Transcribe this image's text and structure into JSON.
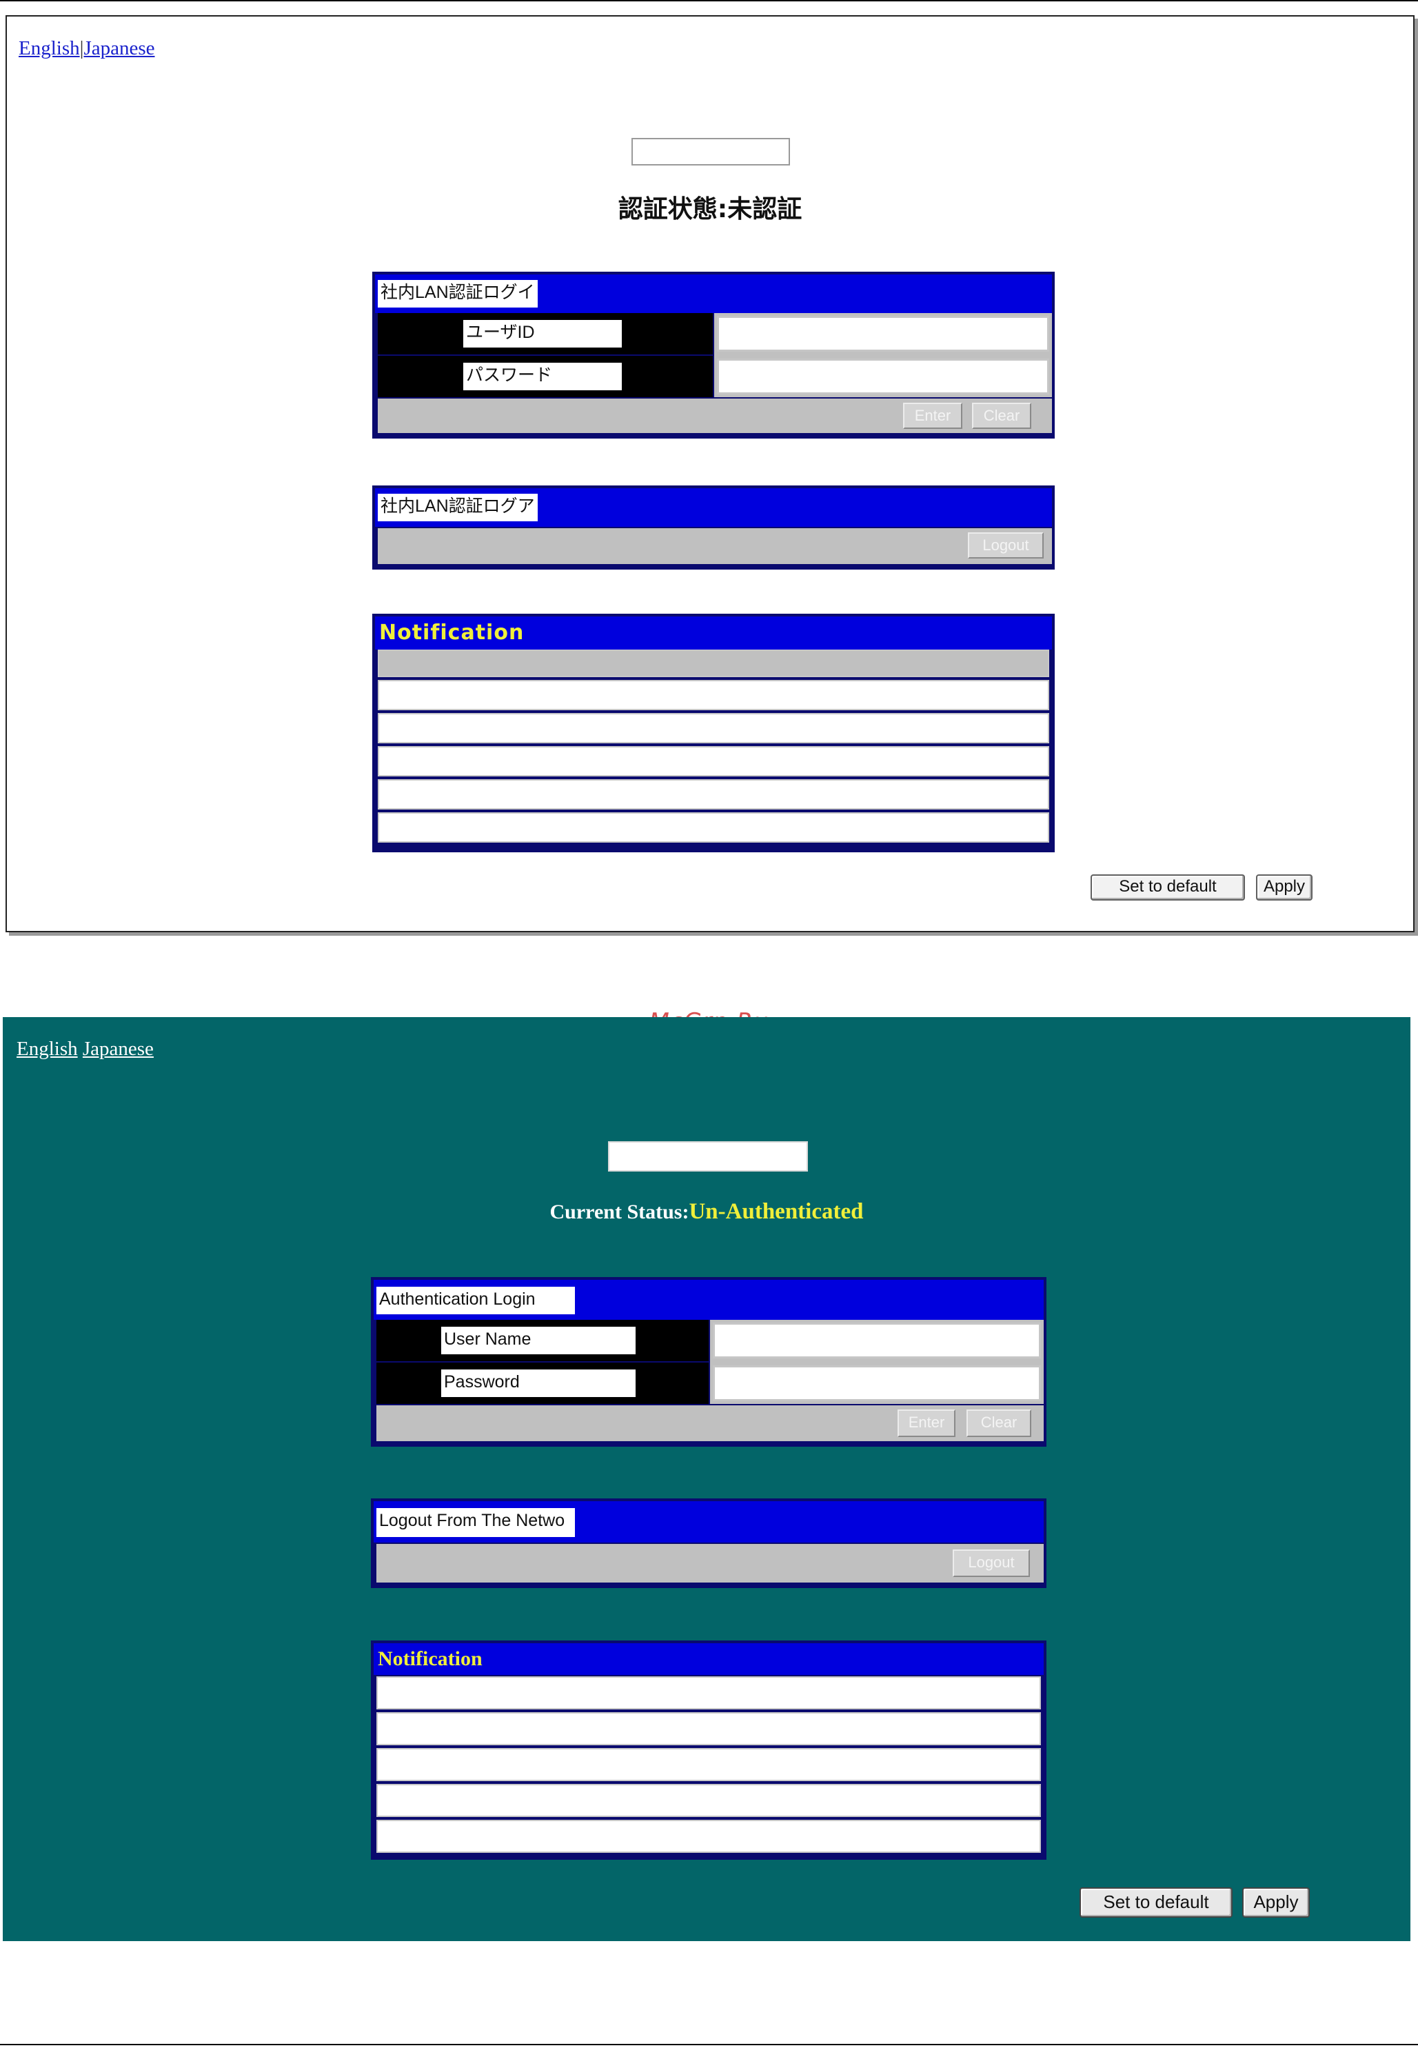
{
  "watermark": "McGrp.Ru",
  "japanese_screen": {
    "lang_english": "English",
    "lang_japanese": "Japanese",
    "status_text": "認証状態:未認証",
    "login_panel": {
      "caption": "社内LAN認証ログイ",
      "user_label": "ユーザID",
      "password_label": "パスワード",
      "user_value": "",
      "password_value": "",
      "enter_button": "Enter",
      "clear_button": "Clear"
    },
    "logout_panel": {
      "caption": "社内LAN認証ログア",
      "logout_button": "Logout"
    },
    "notification": {
      "title": "Notification",
      "rows": [
        "",
        "",
        "",
        "",
        "",
        ""
      ]
    },
    "set_default_button": "Set to default",
    "apply_button": "Apply"
  },
  "english_screen": {
    "lang_english": "English",
    "lang_japanese": "Japanese",
    "status_label": "Current Status:",
    "status_value": "Un-Authenticated",
    "login_panel": {
      "caption": "Authentication Login",
      "user_label": "User Name",
      "password_label": "Password",
      "user_value": "",
      "password_value": "",
      "enter_button": "Enter",
      "clear_button": "Clear"
    },
    "logout_panel": {
      "caption": "Logout From The Netwo",
      "logout_button": "Logout"
    },
    "notification": {
      "title": "Notification",
      "rows": [
        "",
        "",
        "",
        "",
        ""
      ]
    },
    "set_default_button": "Set to default",
    "apply_button": "Apply"
  },
  "colors": {
    "teal_background": "#036568",
    "panel_blue": "#0000dd",
    "panel_border": "#0a0a6e",
    "status_yellow": "#f0ef3a",
    "link_blue": "#1a22cc"
  }
}
